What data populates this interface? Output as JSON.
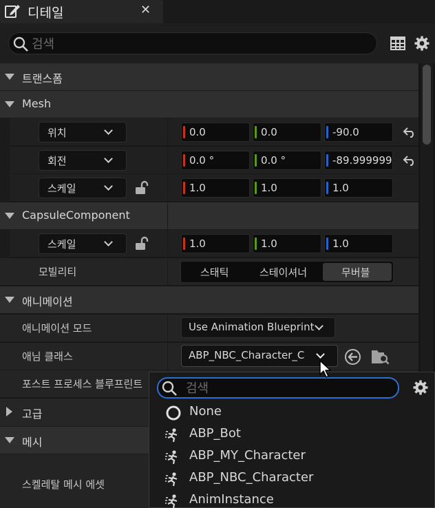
{
  "tab": {
    "title": "디테일",
    "close": "✕"
  },
  "search": {
    "placeholder": "검색"
  },
  "sections": {
    "transform": "트랜스폼",
    "mesh": "Mesh",
    "capsule": "CapsuleComponent",
    "animation": "애니메이션",
    "advanced": "고급",
    "mesh_kr": "메시"
  },
  "mesh": {
    "location": {
      "label": "위치",
      "x": "0.0",
      "y": "0.0",
      "z": "-90.0"
    },
    "rotation": {
      "label": "회전",
      "x": "0.0 °",
      "y": "0.0 °",
      "z": "-89.999999"
    },
    "scale": {
      "label": "스케일",
      "x": "1.0",
      "y": "1.0",
      "z": "1.0"
    }
  },
  "capsule": {
    "scale": {
      "label": "스케일",
      "x": "1.0",
      "y": "1.0",
      "z": "1.0"
    },
    "mobility": {
      "label": "모빌리티",
      "options": [
        "스태틱",
        "스테이셔너",
        "무버블"
      ],
      "selected": "무버블"
    }
  },
  "animation": {
    "mode": {
      "label": "애니메이션 모드",
      "value": "Use Animation Blueprint"
    },
    "class": {
      "label": "애님 클래스",
      "value": "ABP_NBC_Character_C"
    },
    "postprocess": {
      "label": "포스트 프로세스 블루프린트"
    }
  },
  "mesh_section": {
    "skeletal": "스켈레탈 메시 에셋"
  },
  "popup": {
    "placeholder": "검색",
    "items": [
      "None",
      "ABP_Bot",
      "ABP_MY_Character",
      "ABP_NBC_Character",
      "AnimInstance"
    ]
  },
  "colors": {
    "x_axis": "#c8331d",
    "y_axis": "#5a9a1a",
    "z_axis": "#2a62c8",
    "accent": "#2c6fd0"
  }
}
